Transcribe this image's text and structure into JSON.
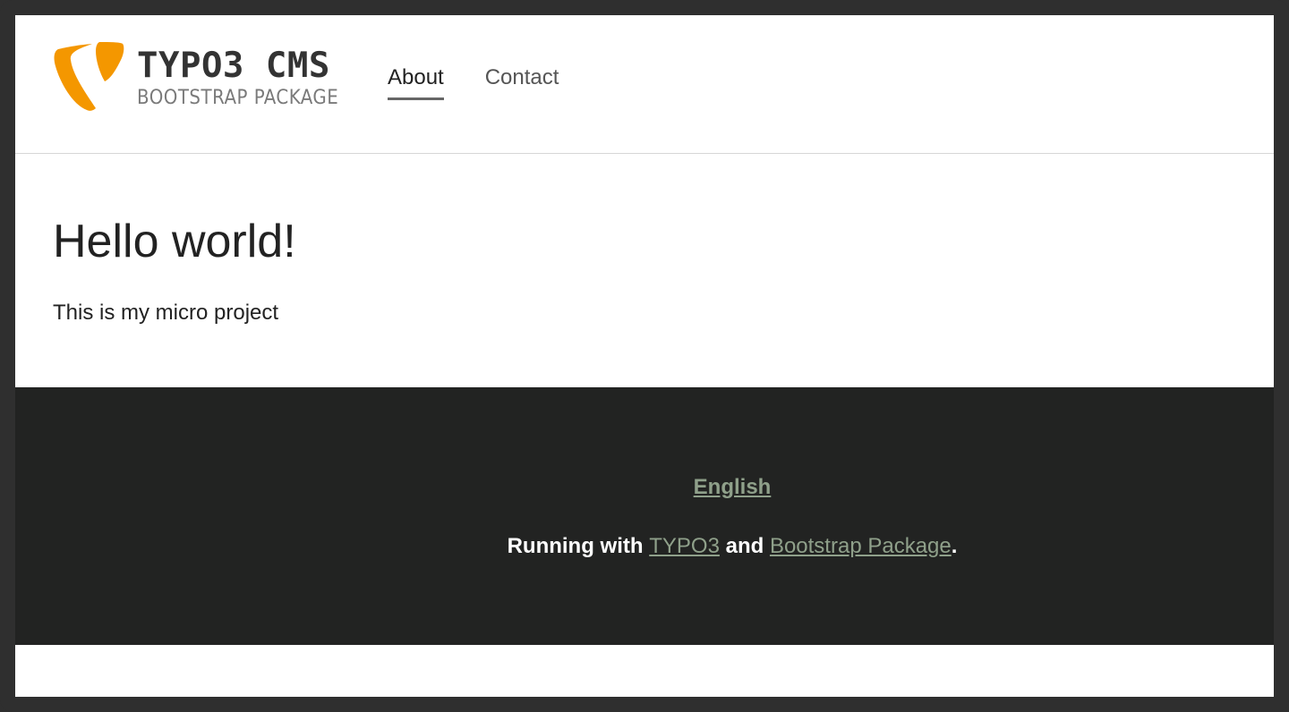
{
  "brand": {
    "title": "TYPO3 CMS",
    "subtitle": "BOOTSTRAP PACKAGE",
    "logo_icon": "typo3-logo-icon",
    "logo_color": "#f49700"
  },
  "nav": {
    "items": [
      {
        "label": "About",
        "active": true
      },
      {
        "label": "Contact",
        "active": false
      }
    ]
  },
  "main": {
    "title": "Hello world!",
    "text": "This is my micro project"
  },
  "footer": {
    "language": "English",
    "credit": {
      "prefix": "Running with",
      "link1": "TYPO3",
      "middle": "and",
      "link2": "Bootstrap Package",
      "suffix": "."
    },
    "background": "#222322",
    "link_color": "#8fa08a"
  }
}
